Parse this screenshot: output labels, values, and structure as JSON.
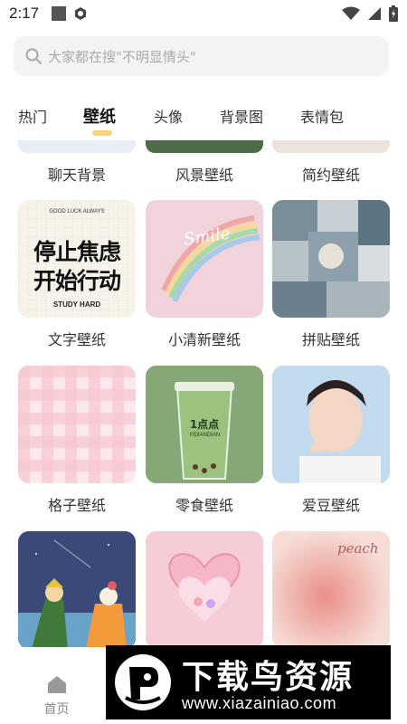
{
  "status_bar": {
    "time": "2:17"
  },
  "search": {
    "placeholder": "大家都在搜\"不明显情头\""
  },
  "tabs": [
    {
      "label": "热门",
      "active": false
    },
    {
      "label": "壁纸",
      "active": true
    },
    {
      "label": "头像",
      "active": false
    },
    {
      "label": "背景图",
      "active": false
    },
    {
      "label": "表情包",
      "active": false
    }
  ],
  "categories": {
    "row0": [
      "聊天背景",
      "风景壁纸",
      "简约壁纸"
    ],
    "row1": [
      "文字壁纸",
      "小清新壁纸",
      "拼贴壁纸"
    ],
    "row2": [
      "格子壁纸",
      "零食壁纸",
      "爱豆壁纸"
    ]
  },
  "thumbs": {
    "text_wallpaper": {
      "top": "GOOD LUCK ALWAYS",
      "line1": "停止焦虑",
      "line2": "开始行动",
      "bottom": "STUDY HARD"
    },
    "fresh_wallpaper": {
      "word": "Smile"
    },
    "snack_wallpaper": {
      "brand": "1点点",
      "sub": "YIDIANDIAN"
    },
    "peach_wallpaper": {
      "word": "peach"
    }
  },
  "bottom_nav": {
    "home_label": "首页"
  },
  "watermark": {
    "title": "下载鸟资源",
    "url": "www.xiazainiao.com"
  },
  "colors": {
    "accent": "#f7c85a",
    "search_bg": "#f3f3f3",
    "placeholder": "#aaaaaa"
  }
}
